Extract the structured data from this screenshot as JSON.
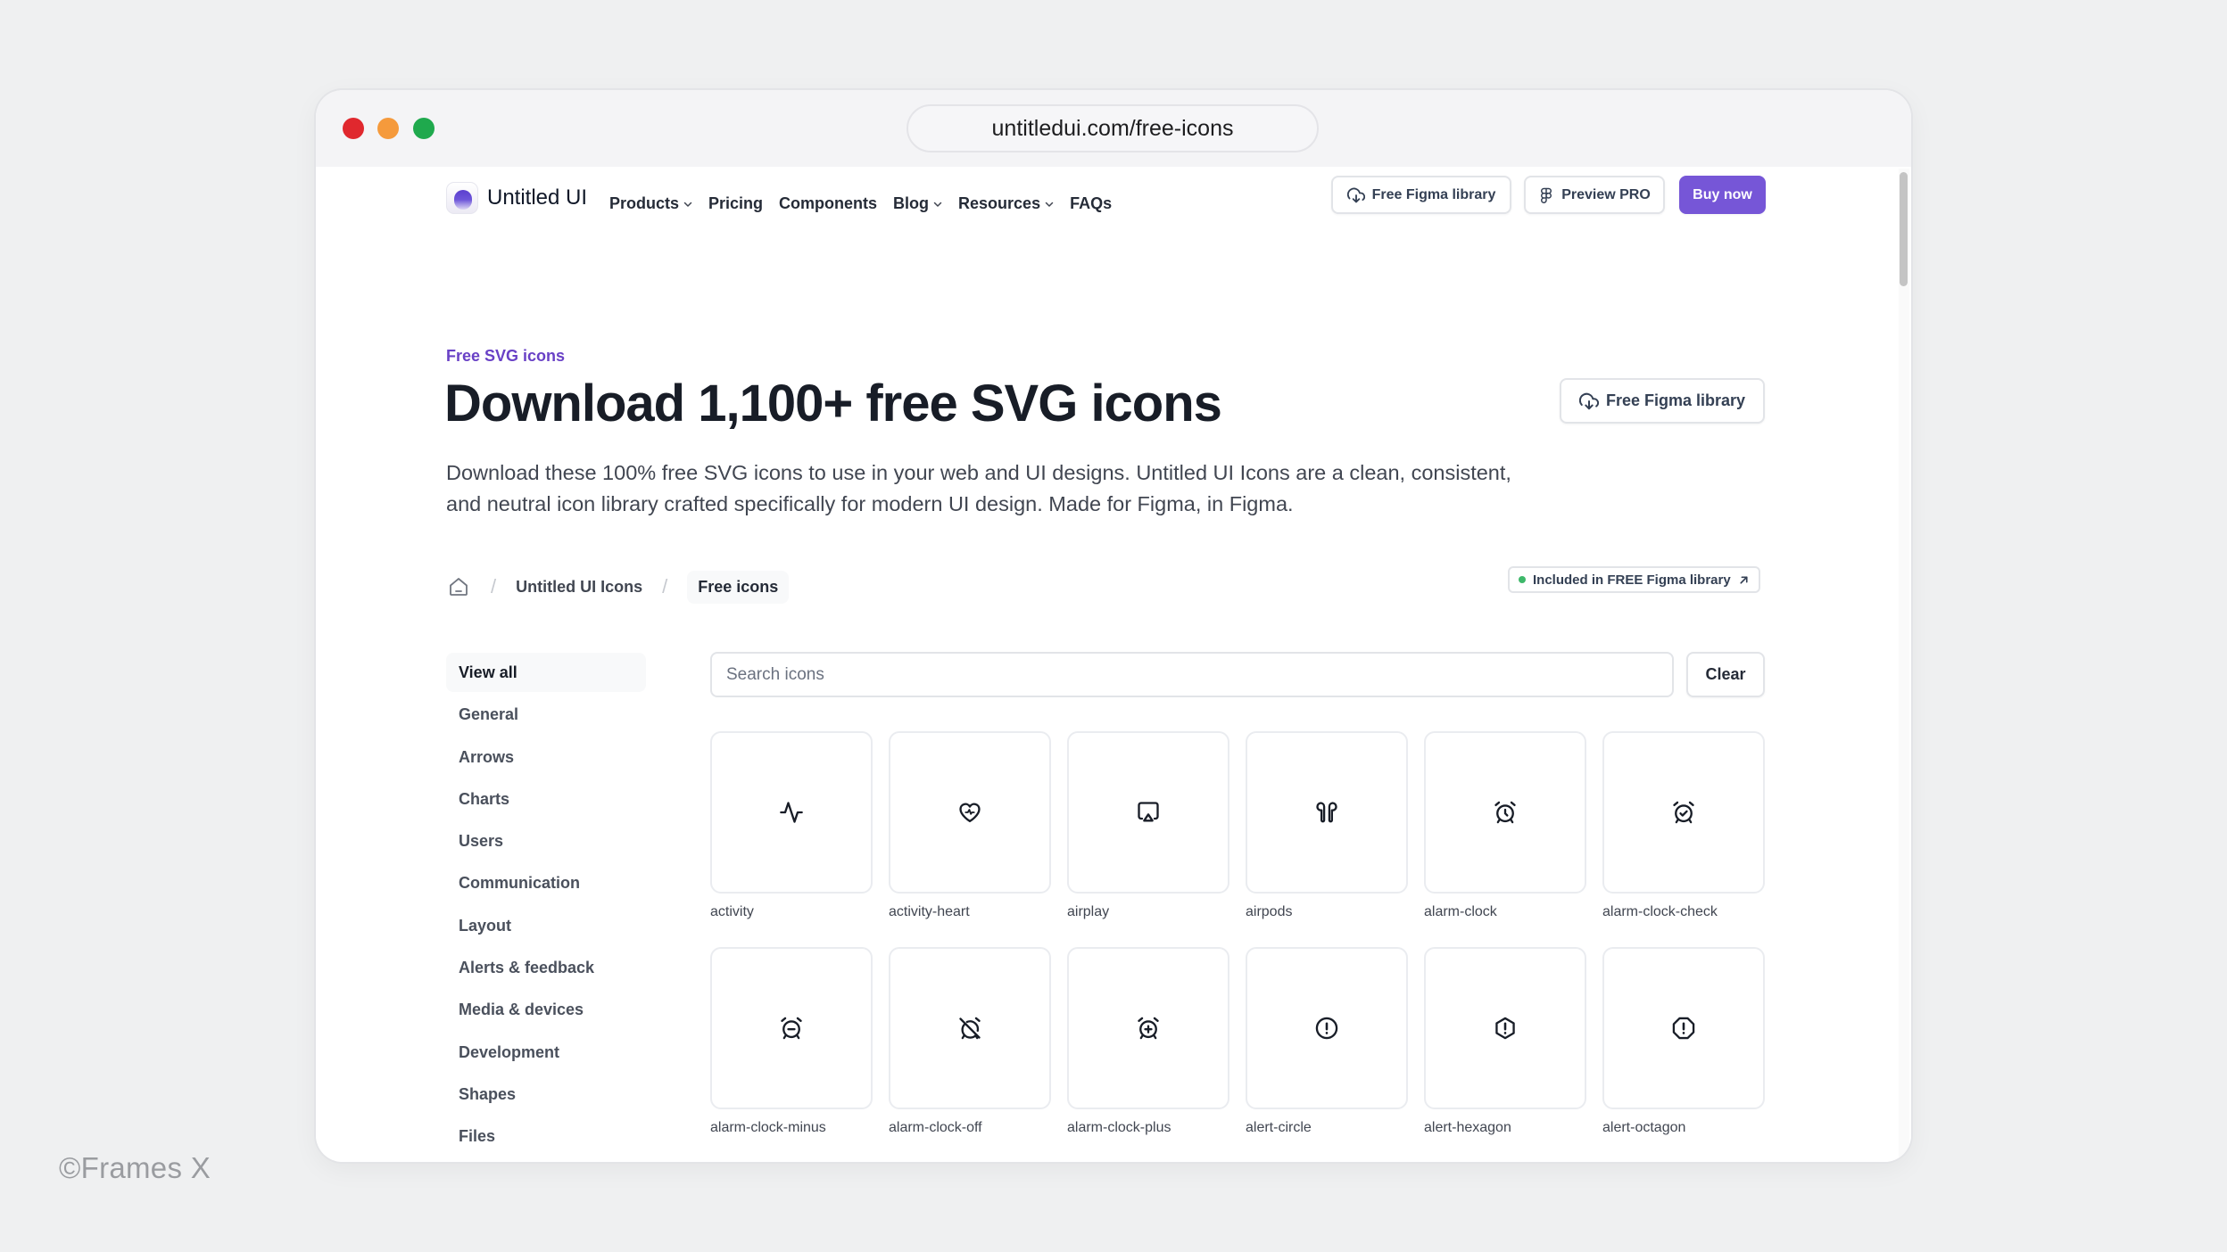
{
  "browser": {
    "url": "untitledui.com/free-icons"
  },
  "nav": {
    "brand": "Untitled UI",
    "links": [
      {
        "label": "Products",
        "dropdown": true
      },
      {
        "label": "Pricing",
        "dropdown": false
      },
      {
        "label": "Components",
        "dropdown": false
      },
      {
        "label": "Blog",
        "dropdown": true
      },
      {
        "label": "Resources",
        "dropdown": true
      },
      {
        "label": "FAQs",
        "dropdown": false
      }
    ],
    "buttons": {
      "figma": "Free Figma library",
      "preview": "Preview PRO",
      "buy": "Buy now"
    }
  },
  "hero": {
    "eyebrow": "Free SVG icons",
    "title": "Download 1,100+ free SVG icons",
    "description": "Download these 100% free SVG icons to use in your web and UI designs. Untitled UI Icons are a clean, consistent, and neutral icon library crafted specifically for modern UI design. Made for Figma, in Figma.",
    "figma_button": "Free Figma library"
  },
  "breadcrumb": {
    "items": [
      "Untitled UI Icons",
      "Free icons"
    ],
    "badge": "Included in FREE Figma library"
  },
  "sidebar": {
    "items": [
      {
        "label": "View all",
        "active": true
      },
      {
        "label": "General"
      },
      {
        "label": "Arrows"
      },
      {
        "label": "Charts"
      },
      {
        "label": "Users"
      },
      {
        "label": "Communication"
      },
      {
        "label": "Layout"
      },
      {
        "label": "Alerts & feedback"
      },
      {
        "label": "Media & devices"
      },
      {
        "label": "Development"
      },
      {
        "label": "Shapes"
      },
      {
        "label": "Files"
      }
    ]
  },
  "search": {
    "placeholder": "Search icons",
    "value": "",
    "clear_label": "Clear"
  },
  "icons": [
    {
      "name": "activity"
    },
    {
      "name": "activity-heart"
    },
    {
      "name": "airplay"
    },
    {
      "name": "airpods"
    },
    {
      "name": "alarm-clock"
    },
    {
      "name": "alarm-clock-check"
    },
    {
      "name": "alarm-clock-minus"
    },
    {
      "name": "alarm-clock-off"
    },
    {
      "name": "alarm-clock-plus"
    },
    {
      "name": "alert-circle"
    },
    {
      "name": "alert-hexagon"
    },
    {
      "name": "alert-octagon"
    }
  ],
  "watermark": "©Frames X",
  "colors": {
    "brand": "#7656d7",
    "eyebrow": "#6941c6",
    "badge_dot": "#3eb86a"
  }
}
